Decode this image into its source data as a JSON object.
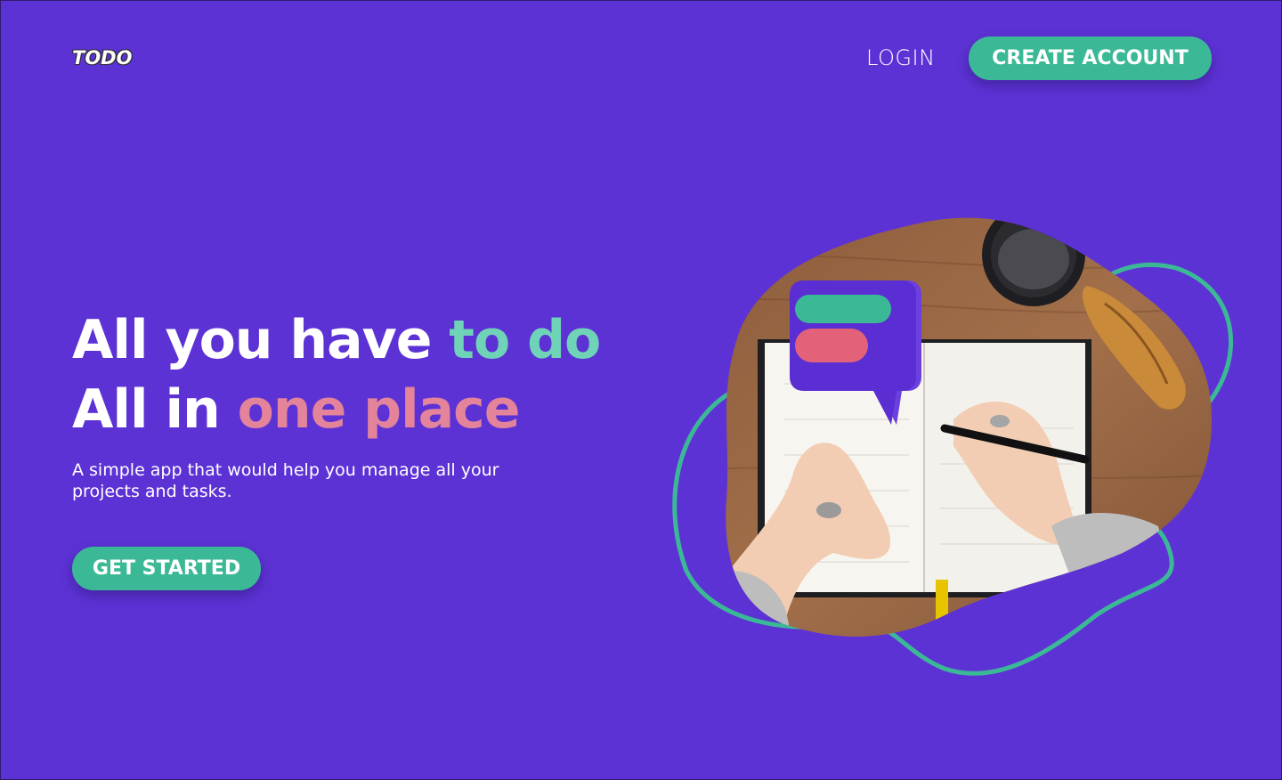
{
  "header": {
    "logo_text": "TODO",
    "login_label": "LOGIN",
    "create_account_label": "CREATE ACCOUNT"
  },
  "hero": {
    "line1_start": "All you have ",
    "line1_accent": "to do",
    "line2_start": "All in ",
    "line2_accent": "one place",
    "subtitle": "A simple app that would help you manage all your projects and tasks.",
    "cta_label": "GET STARTED"
  },
  "colors": {
    "background": "#5D32D5",
    "button": "#3BB996",
    "accent_green": "#6FD3B8",
    "accent_pink": "#E3849A"
  },
  "illustration": {
    "icons": [
      "chat-bubble-icon",
      "coffee-cup-icon",
      "croissant-icon",
      "pen-icon",
      "notebook-icon"
    ]
  }
}
